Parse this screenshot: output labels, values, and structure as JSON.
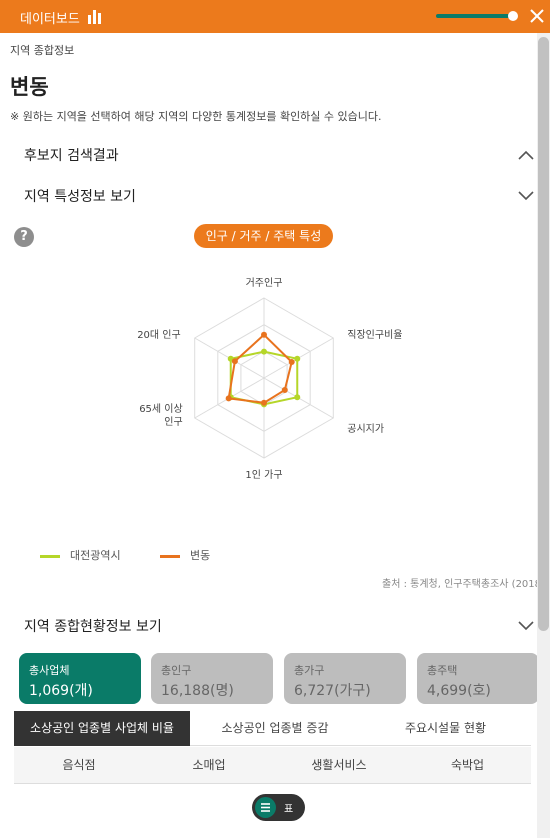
{
  "topbar": {
    "title": "데이터보드",
    "accent_color": "#ec7a1c",
    "chart_icon": "bar-chart-icon",
    "close_icon": "close-icon"
  },
  "breadcrumb": "지역 종합정보",
  "page_title": "변동",
  "notice": "※ 원하는 지역을 선택하여 해당 지역의 다양한 통계정보를 확인하실 수 있습니다.",
  "sections": {
    "candidate_results": "후보지 검색결과",
    "region_features": "지역 특성정보 보기",
    "region_overview": "지역 종합현황정보 보기"
  },
  "feature_pill": "인구 / 거주 / 주택 특성",
  "chart_data": {
    "type": "radar",
    "axes": [
      "거주인구",
      "직장인구비율",
      "공시지가",
      "1인 가구",
      "65세 이상 인구",
      "20대 인구"
    ],
    "scale_rings": 3,
    "series": [
      {
        "name": "대전광역시",
        "color": "#b5d629",
        "values": [
          0.33,
          0.48,
          0.48,
          0.33,
          0.48,
          0.48
        ]
      },
      {
        "name": "변동",
        "color": "#e8731e",
        "values": [
          0.54,
          0.4,
          0.3,
          0.31,
          0.51,
          0.42
        ]
      }
    ],
    "legend_position": "bottom-left"
  },
  "source_text": "출처 : 통계청, 인구주택총조사 (2018",
  "cards": [
    {
      "label": "총사업체",
      "value": "1,069(개)",
      "active": true
    },
    {
      "label": "총인구",
      "value": "16,188(명)",
      "active": false
    },
    {
      "label": "총가구",
      "value": "6,727(가구)",
      "active": false
    },
    {
      "label": "총주택",
      "value": "4,699(호)",
      "active": false
    }
  ],
  "tabs": [
    "소상공인 업종별 사업체 비율",
    "소상공인 업종별 증감",
    "주요시설물 현황"
  ],
  "subcolumns": [
    "음식점",
    "소매업",
    "생활서비스",
    "숙박업"
  ],
  "view_toggle": {
    "label": "표",
    "icon": "list-icon"
  }
}
